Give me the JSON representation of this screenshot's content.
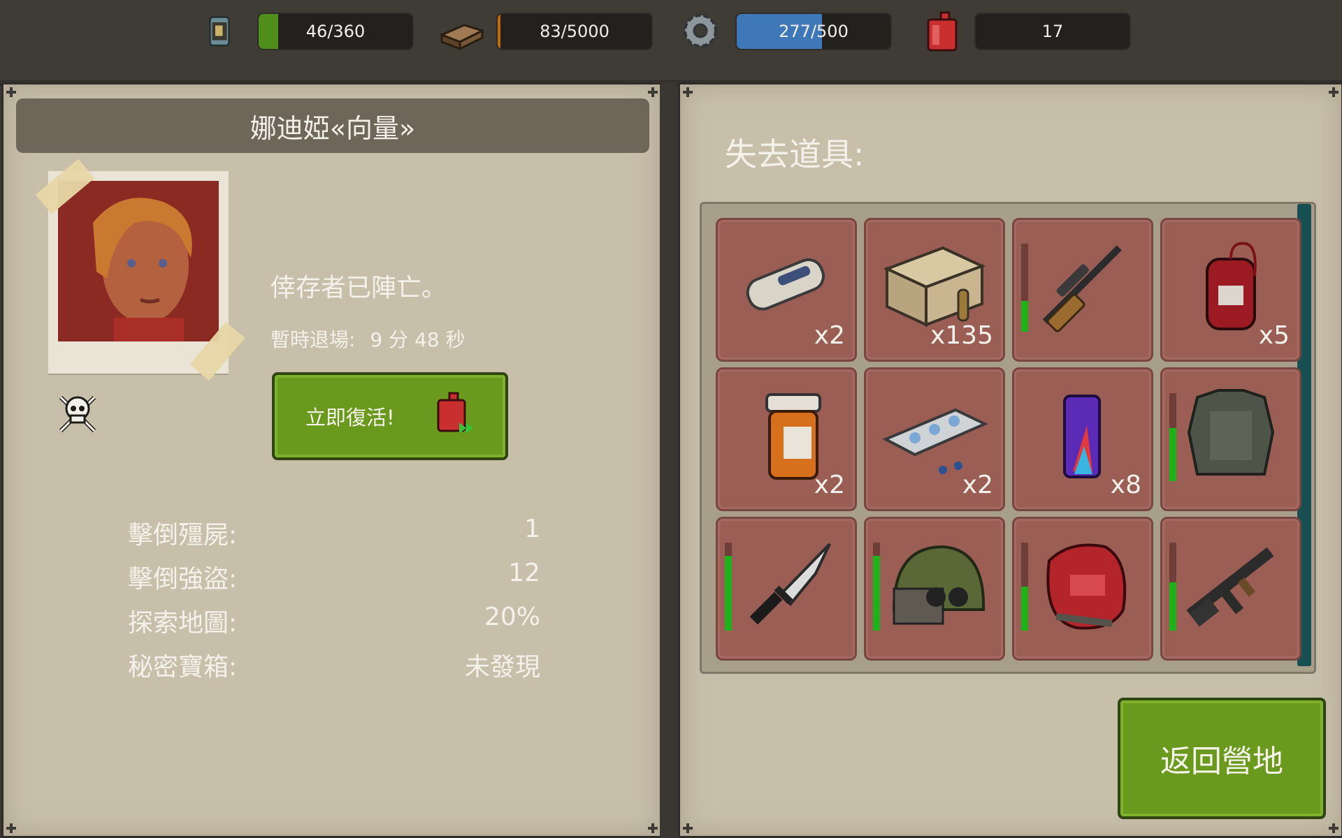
{
  "resources": [
    {
      "icon": "food-can-icon",
      "value": "46/360",
      "fraction": 0.128,
      "color": "#4f8e1a"
    },
    {
      "icon": "wood-planks-icon",
      "value": "83/5000",
      "fraction": 0.017,
      "color": "#c16a12"
    },
    {
      "icon": "gear-parts-icon",
      "value": "277/500",
      "fraction": 0.554,
      "color": "#3e78b8"
    },
    {
      "icon": "fuel-canister-icon",
      "value": "17"
    }
  ],
  "survivor": {
    "name": "娜迪婭«向量»",
    "status": "倖存者已陣亡。",
    "timer_label": "暫時退場:",
    "timer_value": "9 分 48 秒",
    "revive_label": "立即復活!"
  },
  "stats": [
    {
      "label": "擊倒殭屍:",
      "value": "1"
    },
    {
      "label": "擊倒強盜:",
      "value": "12"
    },
    {
      "label": "探索地圖:",
      "value": "20%"
    },
    {
      "label": "秘密寶箱:",
      "value": "未發現"
    }
  ],
  "lost": {
    "title": "失去道具:",
    "items": [
      {
        "icon": "bandage-icon",
        "qty": "x2"
      },
      {
        "icon": "ammo-box-icon",
        "qty": "x135"
      },
      {
        "icon": "sniper-rifle-icon",
        "qty": "",
        "durability": 0.35
      },
      {
        "icon": "blood-bag-icon",
        "qty": "x5"
      },
      {
        "icon": "pill-bottle-icon",
        "qty": "x2"
      },
      {
        "icon": "pill-blister-icon",
        "qty": "x2"
      },
      {
        "icon": "energy-drink-icon",
        "qty": "x8"
      },
      {
        "icon": "body-armor-icon",
        "qty": "",
        "durability": 0.6
      },
      {
        "icon": "combat-knife-icon",
        "qty": "",
        "durability": 0.85
      },
      {
        "icon": "combat-helmet-icon",
        "qty": "",
        "durability": 0.85
      },
      {
        "icon": "backpack-icon",
        "qty": "",
        "durability": 0.5
      },
      {
        "icon": "assault-rifle-icon",
        "qty": "",
        "durability": 0.55
      }
    ]
  },
  "back_label": "返回營地"
}
